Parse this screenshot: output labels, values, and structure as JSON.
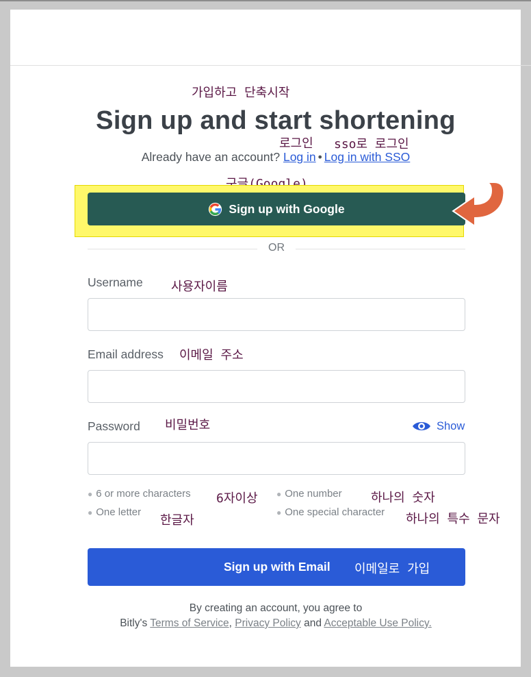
{
  "header": {
    "title": "Sign up and start shortening",
    "account_question": "Already have an account?",
    "login_link": "Log in",
    "separator": "•",
    "sso_link": "Log in with SSO"
  },
  "google": {
    "label": "Sign up with Google"
  },
  "divider": {
    "text": "OR"
  },
  "form": {
    "username_label": "Username",
    "email_label": "Email address",
    "password_label": "Password",
    "show_label": "Show",
    "username_value": "",
    "email_value": "",
    "password_value": ""
  },
  "requirements": [
    "6 or more characters",
    "One number",
    "One letter",
    "One special character"
  ],
  "submit": {
    "label": "Sign up with Email"
  },
  "terms": {
    "line1": "By creating an account, you agree to",
    "prefix": "Bitly's",
    "tos": "Terms of Service",
    "comma": ",",
    "privacy": "Privacy Policy",
    "and": "and",
    "aup": "Acceptable Use Policy."
  },
  "annotations": {
    "title_ko": "가입하고 단축시작",
    "login_ko": "로그인",
    "sso_ko": "sso로 로그인",
    "google_ko": "구글(Google)",
    "username_ko": "사용자이름",
    "email_ko": "이메일 주소",
    "password_ko": "비밀번호",
    "six_chars_ko": "6자이상",
    "one_number_ko": "하나의 숫자",
    "one_letter_ko": "한글자",
    "special_ko": "하나의 특수 문자",
    "email_signup_ko": "이메일로 가입"
  },
  "colors": {
    "google_button": "#275a53",
    "email_button": "#2a5bd7",
    "highlight": "#fff86a",
    "arrow": "#e0663f",
    "annotation_text": "#5a1745"
  }
}
